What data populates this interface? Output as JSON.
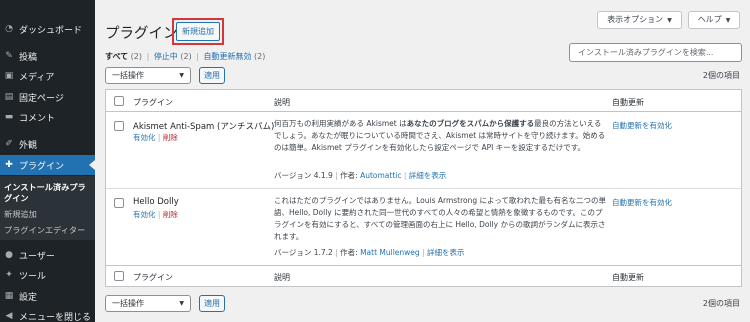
{
  "sidebar": {
    "items": [
      {
        "label": "ダッシュボード",
        "icon": "dashboard-icon"
      },
      {
        "label": "投稿",
        "icon": "pin-icon"
      },
      {
        "label": "メディア",
        "icon": "media-icon"
      },
      {
        "label": "固定ページ",
        "icon": "page-icon"
      },
      {
        "label": "コメント",
        "icon": "comment-icon"
      },
      {
        "label": "外観",
        "icon": "appearance-icon"
      },
      {
        "label": "プラグイン",
        "icon": "plugin-icon"
      },
      {
        "label": "ユーザー",
        "icon": "user-icon"
      },
      {
        "label": "ツール",
        "icon": "tool-icon"
      },
      {
        "label": "設定",
        "icon": "settings-icon"
      },
      {
        "label": "メニューを閉じる",
        "icon": "collapse-icon"
      }
    ],
    "submenu": {
      "installed": "インストール済みプラグイン",
      "add_new": "新規追加",
      "editor": "プラグインエディター"
    }
  },
  "header": {
    "title": "プラグイン",
    "add_new": "新規追加",
    "screen_options": "表示オプション",
    "help": "ヘルプ"
  },
  "filters": {
    "all": "すべて",
    "all_count": "(2)",
    "inactive": "停止中",
    "inactive_count": "(2)",
    "auto_update_disabled": "自動更新無効",
    "auto_update_disabled_count": "(2)",
    "separator": "|"
  },
  "search": {
    "placeholder": "インストール済みプラグインを検索..."
  },
  "bulk": {
    "label": "一括操作",
    "apply": "適用",
    "count": "2個の項目"
  },
  "table": {
    "col_plugin": "プラグイン",
    "col_desc": "説明",
    "col_auto": "自動更新",
    "rows": [
      {
        "name": "Akismet Anti-Spam (アンチスパム)",
        "activate": "有効化",
        "delete": "削除",
        "sep": "|",
        "desc_1": "何百万もの利用実績がある Akismet は",
        "desc_bold": "あなたのブログをスパムから保護する",
        "desc_2": "最良の方法といえるでしょう。あなたが眠りについている時間でさえ、Akismet は常時サイトを守り続けます。始めるのは簡単。Akismet プラグインを有効化したら設定ページで API キーを設定するだけです。",
        "version": "バージョン 4.1.9",
        "author_label": "作者: ",
        "author": "Automattic",
        "details": "詳細を表示",
        "auto": "自動更新を有効化"
      },
      {
        "name": "Hello Dolly",
        "activate": "有効化",
        "delete": "削除",
        "sep": "|",
        "desc": "これはただのプラグインではありません。Louis Armstrong によって歌われた最も有名な二つの単語、Hello, Dolly に要約された同一世代のすべての人々の希望と情熱を象徴するものです。このプラグインを有効にすると、すべての管理画面の右上に Hello, Dolly からの歌詞がランダムに表示されます。",
        "version": "バージョン 1.7.2",
        "author_label": "作者: ",
        "author": "Matt Mullenweg",
        "details": "詳細を表示",
        "auto": "自動更新を有効化"
      }
    ]
  }
}
